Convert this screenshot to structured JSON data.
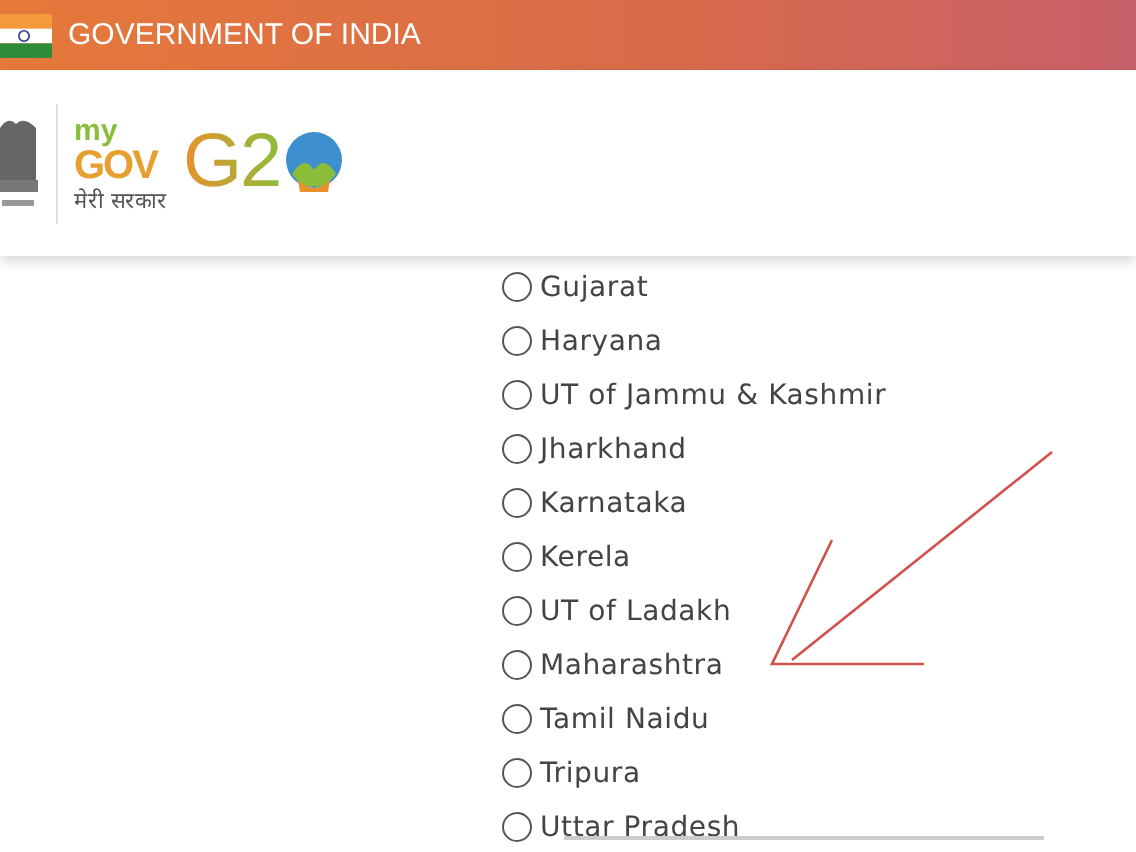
{
  "top_bar": {
    "title": "GOVERNMENT OF INDIA"
  },
  "header": {
    "mygov_logo": {
      "line_1": "my",
      "line_2": "GOV",
      "tagline": "मेरी सरकार"
    },
    "g20_logo": {
      "text": "G2"
    }
  },
  "states": [
    {
      "label": "Gujarat",
      "selected": false
    },
    {
      "label": "Haryana",
      "selected": false
    },
    {
      "label": "UT of Jammu & Kashmir",
      "selected": false
    },
    {
      "label": "Jharkhand",
      "selected": false
    },
    {
      "label": "Karnataka",
      "selected": false
    },
    {
      "label": "Kerela",
      "selected": false
    },
    {
      "label": "UT of Ladakh",
      "selected": false
    },
    {
      "label": "Maharashtra",
      "selected": false
    },
    {
      "label": "Tamil Naidu",
      "selected": false
    },
    {
      "label": "Tripura",
      "selected": false
    },
    {
      "label": "Uttar Pradesh",
      "selected": false
    }
  ]
}
